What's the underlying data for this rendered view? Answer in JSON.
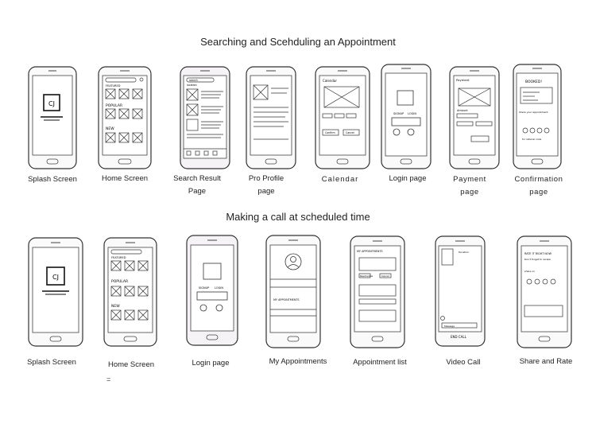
{
  "sections": [
    {
      "title": "Searching and Scehduling an Appointment",
      "screens": [
        {
          "line1": "Splash  Screen",
          "line2": ""
        },
        {
          "line1": "Home  Screen",
          "line2": ""
        },
        {
          "line1": "Search Result",
          "line2": "Page"
        },
        {
          "line1": "Pro  Profile",
          "line2": "page"
        },
        {
          "line1": "Calendar",
          "line2": ""
        },
        {
          "line1": "Login  page",
          "line2": ""
        },
        {
          "line1": "Payment",
          "line2": "page"
        },
        {
          "line1": "Confirmation",
          "line2": "page"
        }
      ]
    },
    {
      "title": "Making a call at scheduled time",
      "screens": [
        {
          "line1": "Splash  Screen",
          "line2": ""
        },
        {
          "line1": "Home  Screen",
          "line2": ""
        },
        {
          "line1": "Login  page",
          "line2": ""
        },
        {
          "line1": "My Appointments",
          "line2": ""
        },
        {
          "line1": "Appointment list",
          "line2": ""
        },
        {
          "line1": "Video  Call",
          "line2": ""
        },
        {
          "line1": "Share and Rate",
          "line2": ""
        }
      ]
    }
  ],
  "sketch_text": {
    "logo": "CJ",
    "popular": "POPULAR",
    "new": "NEW",
    "featured": "FEATURED",
    "search": "search",
    "location": "location",
    "calendar": "Calendar",
    "signup": "SIGNUP",
    "login": "LOGIN",
    "confirm": "Confirm",
    "cancel": "Cancel",
    "payment": "Payment",
    "amount": "Amount",
    "booked": "BOOKED!",
    "share_prompt": "Share your appointment",
    "referral": "for referral code",
    "my_appointments": "MY APPOINTMENTS",
    "reschedule": "Reschedule",
    "end_call": "END CALL",
    "message": "Message",
    "duration": "Duration",
    "rate_prompt": "RATE IT RIGHT NOW",
    "forget": "Don't forget to review",
    "share_on": "share on",
    "bottom_mark": "="
  }
}
